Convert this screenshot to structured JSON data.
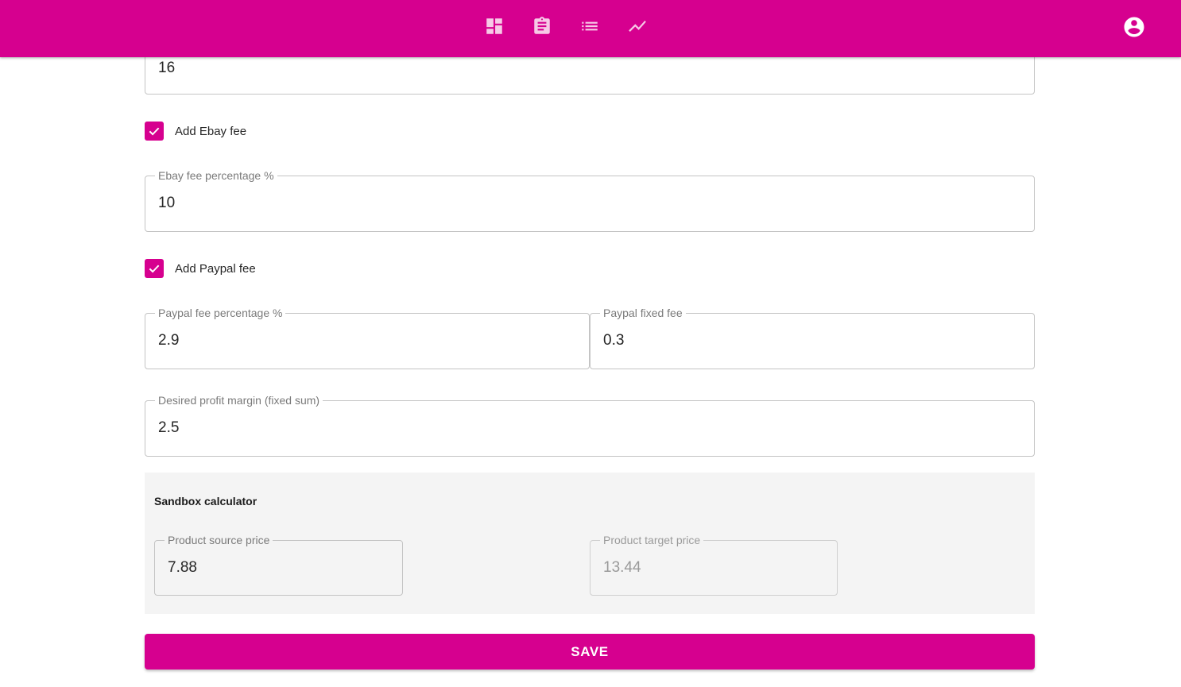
{
  "colors": {
    "brand": "#d6008f",
    "panel_background": "#f4f4f4"
  },
  "header": {
    "nav_icons": [
      "dashboard-icon",
      "clipboard-icon",
      "list-icon",
      "trend-chart-icon"
    ],
    "account_icon": "account-circle-icon"
  },
  "form": {
    "top_field": {
      "value": "16"
    },
    "ebay_fee_checkbox": {
      "label": "Add Ebay fee",
      "checked": true
    },
    "ebay_fee_percentage": {
      "label": "Ebay fee percentage %",
      "value": "10"
    },
    "paypal_fee_checkbox": {
      "label": "Add Paypal fee",
      "checked": true
    },
    "paypal_fee_percentage": {
      "label": "Paypal fee percentage %",
      "value": "2.9"
    },
    "paypal_fixed_fee": {
      "label": "Paypal fixed fee",
      "value": "0.3"
    },
    "desired_profit_margin": {
      "label": "Desired profit margin (fixed sum)",
      "value": "2.5"
    }
  },
  "sandbox": {
    "title": "Sandbox calculator",
    "source_price": {
      "label": "Product source price",
      "value": "7.88"
    },
    "target_price": {
      "label": "Product target price",
      "value": "13.44",
      "disabled": true
    }
  },
  "actions": {
    "save_label": "SAVE"
  }
}
